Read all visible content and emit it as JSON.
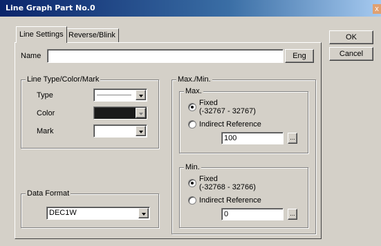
{
  "window": {
    "title": "Line Graph Part No.0",
    "close_label": "x"
  },
  "tabs": [
    {
      "label": "Line Settings",
      "active": true
    },
    {
      "label": "Reverse/Blink",
      "active": false
    }
  ],
  "buttons": {
    "ok": "OK",
    "cancel": "Cancel",
    "eng": "Eng",
    "ellipsis": "..."
  },
  "name_field": {
    "label": "Name",
    "value": ""
  },
  "line_group": {
    "title": "Line Type/Color/Mark",
    "type_label": "Type",
    "color_label": "Color",
    "mark_label": "Mark",
    "color_value": "#1a1a1a"
  },
  "data_format": {
    "title": "Data Format",
    "value": "DEC1W"
  },
  "maxmin": {
    "title": "Max./Min.",
    "max": {
      "title": "Max.",
      "fixed_label": "Fixed",
      "fixed_range": "(-32767 - 32767)",
      "indirect_label": "Indirect Reference",
      "selected": "fixed",
      "value": "100"
    },
    "min": {
      "title": "Min.",
      "fixed_label": "Fixed",
      "fixed_range": "(-32768 - 32766)",
      "indirect_label": "Indirect Reference",
      "selected": "fixed",
      "value": "0"
    }
  }
}
